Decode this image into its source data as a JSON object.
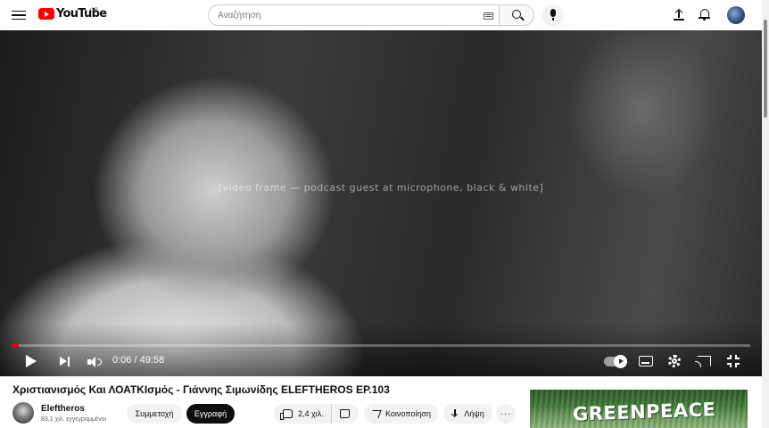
{
  "header": {
    "logo_text": "YouTube",
    "region": "GR",
    "search_placeholder": "Αναζήτηση"
  },
  "player": {
    "placeholder_caption": "[video frame — podcast guest at microphone, black & white]",
    "time": "0:06 / 49:58",
    "progress": 0.01,
    "progress_color": "#ff0000"
  },
  "video": {
    "title": "Χριστιανισμός Και ΛΟΑΤΚΙσμός - Γιάννης Σιμωνίδης ELEFTHEROS EP.103"
  },
  "channel": {
    "name": "Eleftheros",
    "subscribers": "83,1 χιλ. εγγεγραμμένοι"
  },
  "actions": {
    "join_label": "Συμμετοχή",
    "subscribe_label": "Εγγραφή",
    "like_count": "2,4 χιλ.",
    "share_label": "Κοινοποίηση",
    "download_label": "Λήψη",
    "more_label": "···"
  },
  "sidebar": {
    "thumbnail_text": "GREENPEACE"
  }
}
